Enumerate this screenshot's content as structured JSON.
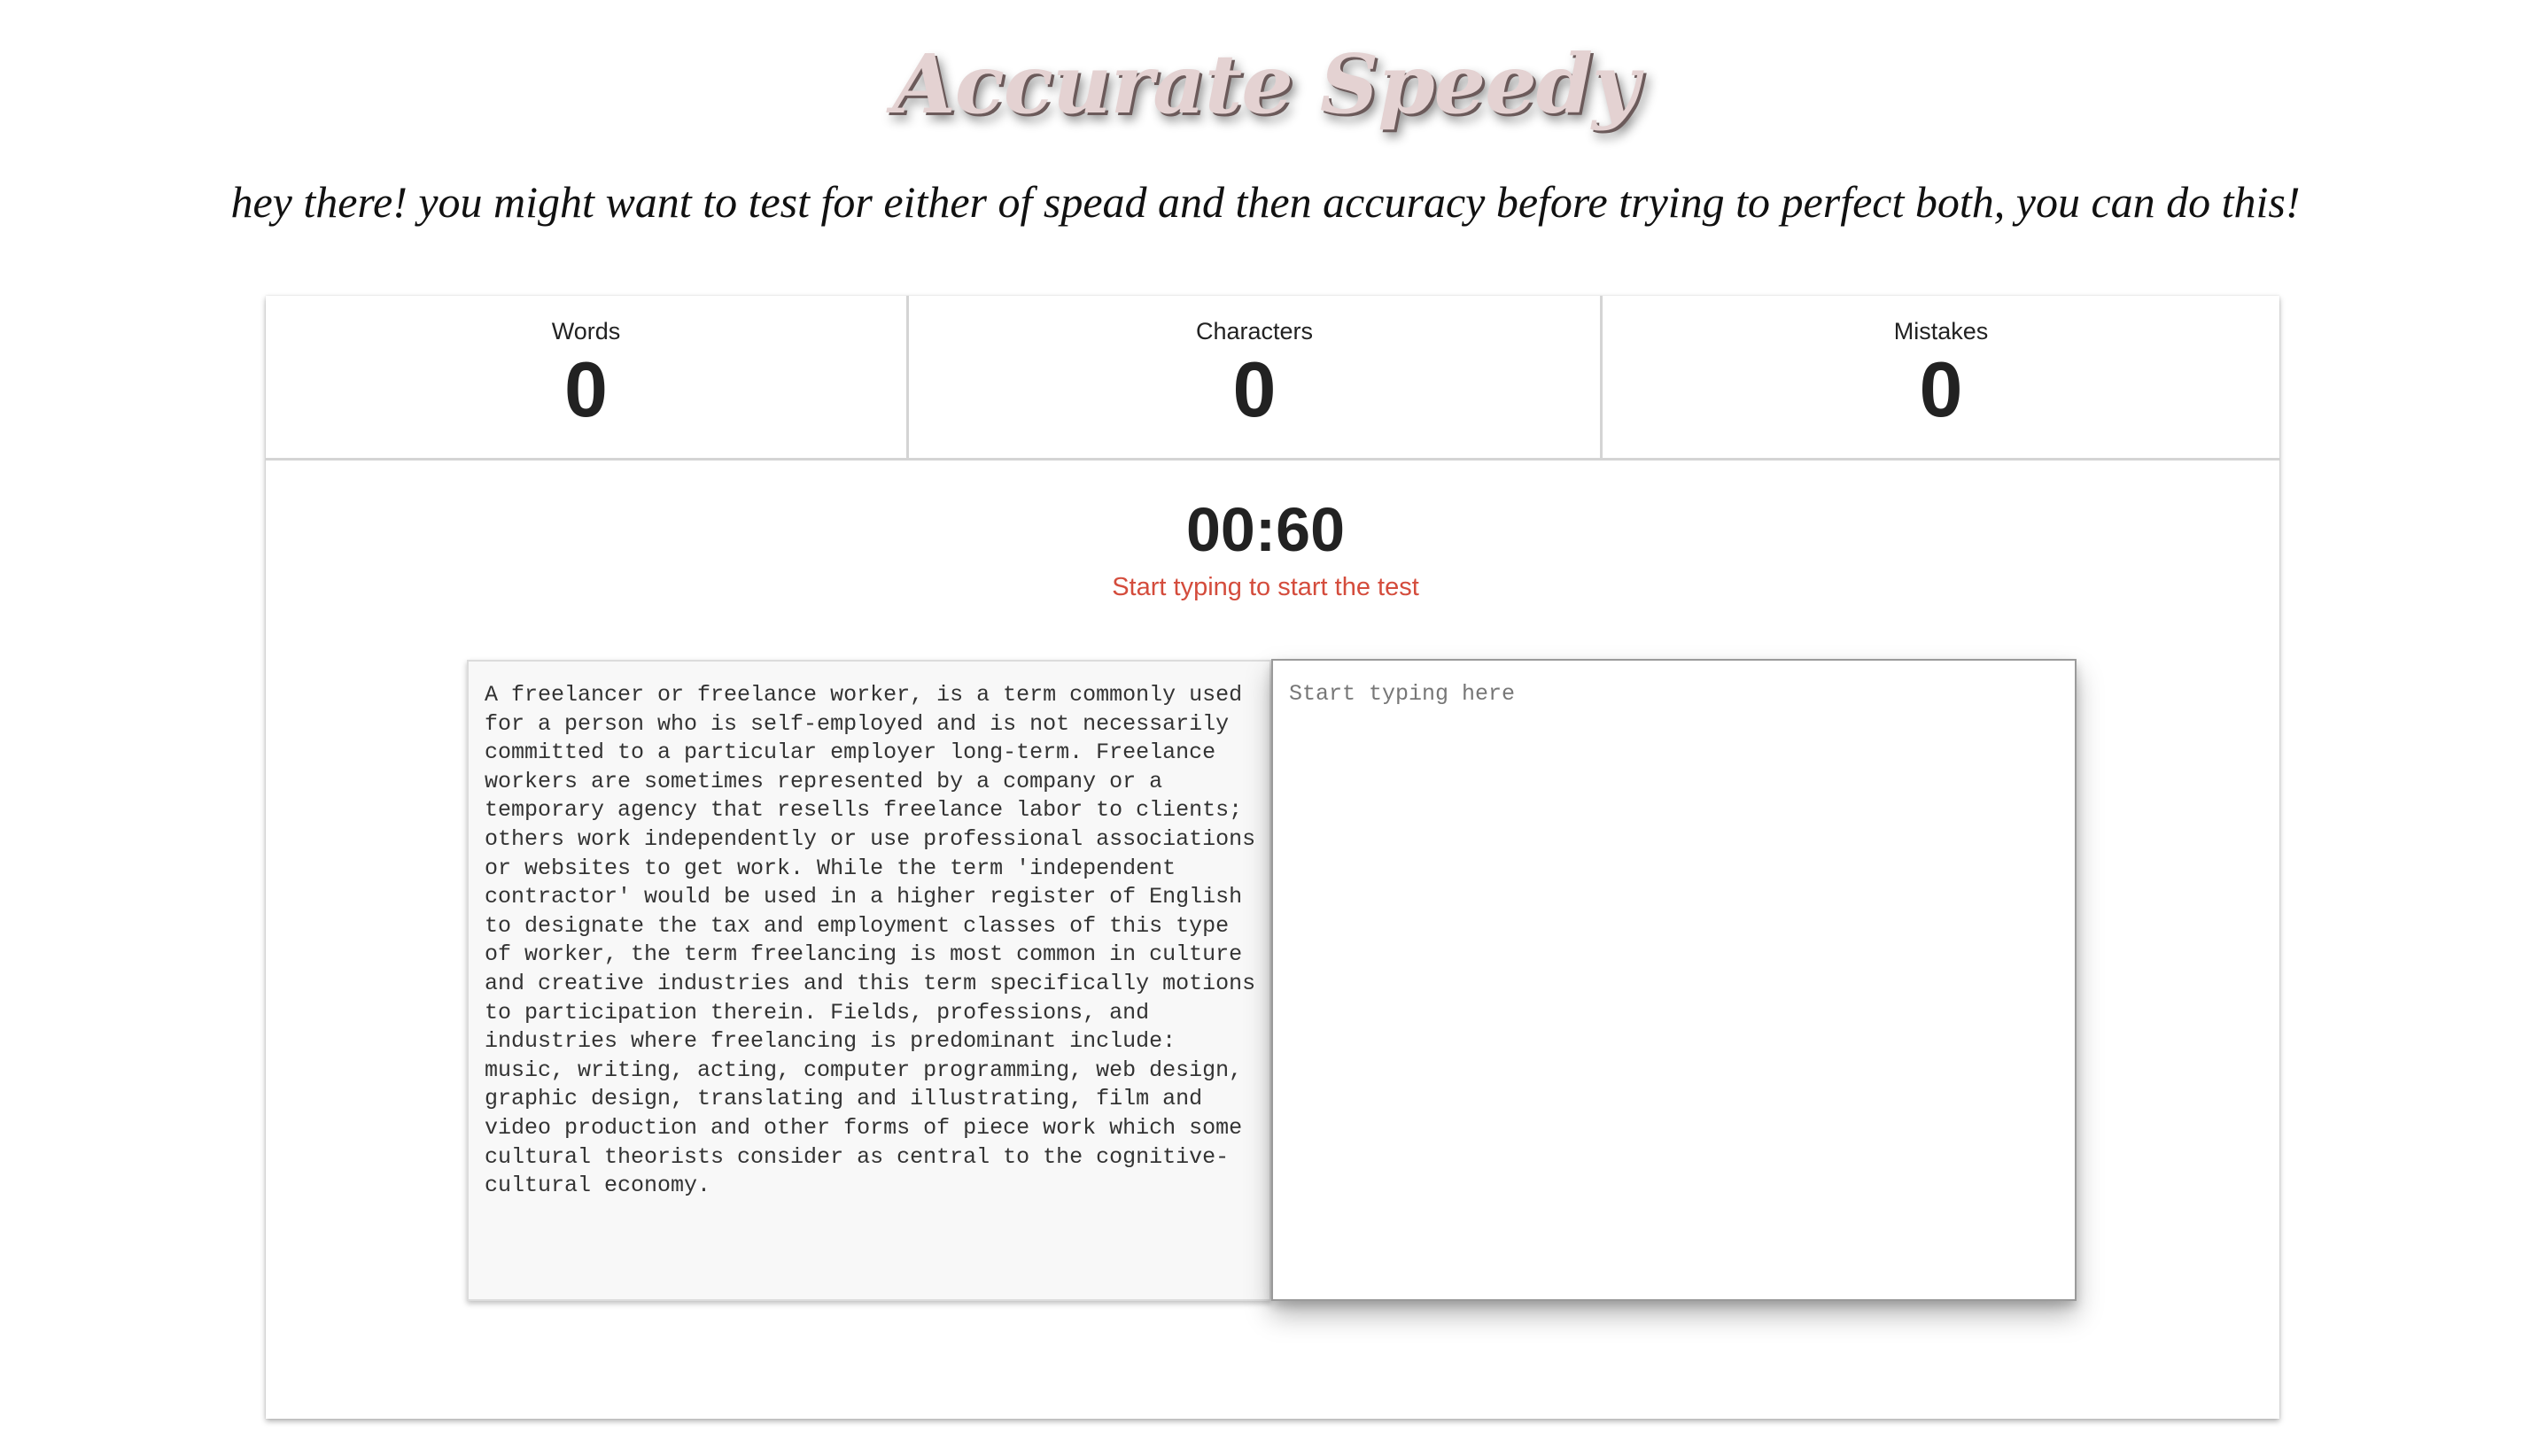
{
  "header": {
    "title": "Accurate Speedy",
    "subtitle": "hey there! you might want to test for either of spead and then accuracy before trying to perfect both, you can do this!"
  },
  "stats": {
    "words": {
      "label": "Words",
      "value": "0"
    },
    "characters": {
      "label": "Characters",
      "value": "0"
    },
    "mistakes": {
      "label": "Mistakes",
      "value": "0"
    }
  },
  "timer": {
    "display": "00:60",
    "hint": "Start typing to start the test"
  },
  "test": {
    "source_text": "A freelancer or freelance worker, is a term commonly used for a person who is self-employed and is not necessarily committed to a particular employer long-term. Freelance workers are sometimes represented by a company or a temporary agency that resells freelance labor to clients; others work independently or use professional associations or websites to get work. While the term 'independent contractor' would be used in a higher register of English to designate the tax and employment classes of this type of worker, the term freelancing is most common in culture and creative industries and this term specifically motions to participation therein. Fields, professions, and industries where freelancing is predominant include: music, writing, acting, computer programming, web design, graphic design, translating and illustrating, film and video production and other forms of piece work which some cultural theorists consider as central to the cognitive-cultural economy.",
    "input_value": "",
    "input_placeholder": "Start typing here"
  },
  "colors": {
    "title_fill": "#e4d2d2",
    "hint": "#d44c3c",
    "text": "#222222",
    "source_background": "#f8f8f8"
  }
}
